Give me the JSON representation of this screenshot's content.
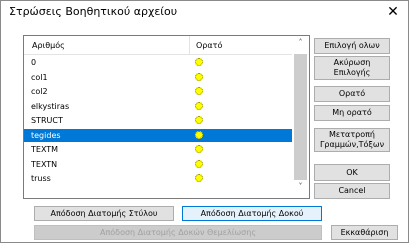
{
  "window": {
    "title": "Στρώσεις Βοηθητικού αρχείου",
    "close_symbol": "✕"
  },
  "list": {
    "headers": {
      "name": "Αριθμός",
      "visible": "Ορατό"
    },
    "rows": [
      {
        "name": "0",
        "visible": true,
        "selected": false
      },
      {
        "name": "col1",
        "visible": true,
        "selected": false
      },
      {
        "name": "col2",
        "visible": true,
        "selected": false
      },
      {
        "name": "elkystiras",
        "visible": true,
        "selected": false
      },
      {
        "name": "STRUCT",
        "visible": true,
        "selected": false
      },
      {
        "name": "tegides",
        "visible": true,
        "selected": true
      },
      {
        "name": "TEXTM",
        "visible": true,
        "selected": false
      },
      {
        "name": "TEXTN",
        "visible": true,
        "selected": false
      },
      {
        "name": "truss",
        "visible": true,
        "selected": false
      }
    ],
    "visible_icon": "lightbulb-on-icon"
  },
  "scrollbar": {
    "up": "˄",
    "down": "˅"
  },
  "buttons": {
    "select_all": "Επιλογή ολων",
    "cancel_selection": "Ακύρωση Επιλογής",
    "visible": "Ορατό",
    "not_visible": "Μη ορατό",
    "convert": "Μετατροπή Γραμμών,Τόξων",
    "ok": "OK",
    "cancel": "Cancel",
    "assign_column": "Απόδοση Διατομής Στύλου",
    "assign_beam": "Απόδοση Διατομής Δοκού",
    "assign_foundation": "Απόδοση Διατομής Δοκών Θεμελίωσης",
    "clear": "Εκκαθάριση"
  },
  "colors": {
    "selection": "#0078d7",
    "bulb": "#ffff00",
    "focus_border": "#0078d7"
  }
}
